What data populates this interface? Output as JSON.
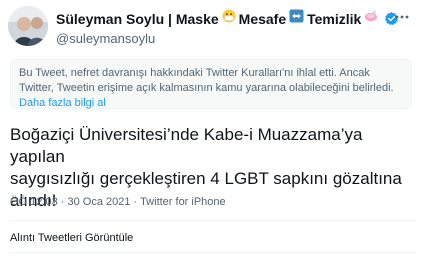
{
  "profile": {
    "name_part1": "Süleyman Soylu | Maske",
    "name_part2": "Mesafe",
    "name_part3": "Temizlik",
    "handle": "@suleymansoylu",
    "verified": true,
    "emoji_mask": "face-with-mask",
    "emoji_arrows": "left-right-arrow",
    "emoji_soap": "soap"
  },
  "notice": {
    "text": "Bu Tweet, nefret davranışı hakkındaki Twitter Kuralları'nı ihlal etti. Ancak Twitter, Tweetin erişime açık kalmasının kamu yararına olabileceğini belirledi. ",
    "link": "Daha fazla bilgi al"
  },
  "tweet": {
    "line1": "Boğaziçi Üniversitesi’nde Kabe-i Muazzama’ya yapılan",
    "line2": "saygısızlığı gerçekleştiren 4 LGBT sapkını gözaltına",
    "line3": "alındı!"
  },
  "meta": {
    "time": "ÖÖ 12:03",
    "dot": " · ",
    "date": "30 Oca 2021",
    "source": "Twitter for iPhone"
  },
  "footer": {
    "quotes_link": "Alıntı Tweetleri Görüntüle"
  },
  "colors": {
    "accent": "#1d9bf0",
    "secondary_text": "#536471",
    "notice_bg": "#f7f9f9"
  }
}
